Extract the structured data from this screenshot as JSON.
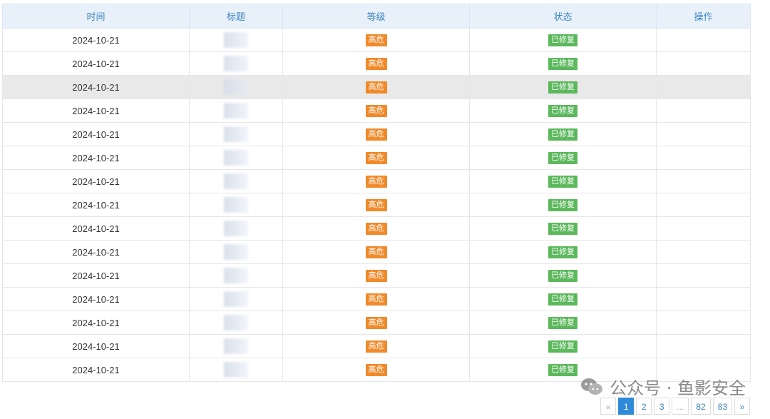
{
  "table": {
    "headers": [
      "时间",
      "标题",
      "等级",
      "状态",
      "操作"
    ],
    "rows": [
      {
        "time": "2024-10-21",
        "level": "高危",
        "status": "已修复"
      },
      {
        "time": "2024-10-21",
        "level": "高危",
        "status": "已修复"
      },
      {
        "time": "2024-10-21",
        "level": "高危",
        "status": "已修复"
      },
      {
        "time": "2024-10-21",
        "level": "高危",
        "status": "已修复"
      },
      {
        "time": "2024-10-21",
        "level": "高危",
        "status": "已修复"
      },
      {
        "time": "2024-10-21",
        "level": "高危",
        "status": "已修复"
      },
      {
        "time": "2024-10-21",
        "level": "高危",
        "status": "已修复"
      },
      {
        "time": "2024-10-21",
        "level": "高危",
        "status": "已修复"
      },
      {
        "time": "2024-10-21",
        "level": "高危",
        "status": "已修复"
      },
      {
        "time": "2024-10-21",
        "level": "高危",
        "status": "已修复"
      },
      {
        "time": "2024-10-21",
        "level": "高危",
        "status": "已修复"
      },
      {
        "time": "2024-10-21",
        "level": "高危",
        "status": "已修复"
      },
      {
        "time": "2024-10-21",
        "level": "高危",
        "status": "已修复"
      },
      {
        "time": "2024-10-21",
        "level": "高危",
        "status": "已修复"
      },
      {
        "time": "2024-10-21",
        "level": "高危",
        "status": "已修复"
      }
    ]
  },
  "pagination": {
    "prev": "«",
    "next": "»",
    "pages": [
      "1",
      "2",
      "3",
      "...",
      "82",
      "83"
    ],
    "current": "1"
  },
  "watermark": {
    "text": "公众号 · 鱼影安全",
    "icon": "wechat-icon"
  },
  "colors": {
    "header_text": "#3c83c0",
    "header_bg": "#e8f1fa",
    "level_badge": "#f08a2a",
    "status_badge": "#5cb85c",
    "active_page": "#2f8bd8"
  }
}
